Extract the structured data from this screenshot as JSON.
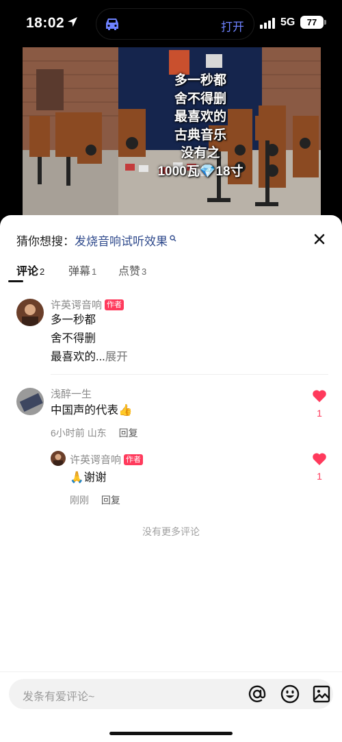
{
  "status_bar": {
    "time": "18:02",
    "island_action": "打开",
    "network": "5G",
    "battery": "77"
  },
  "video": {
    "overlay_lines": [
      "多一秒都",
      "舍不得删",
      "最喜欢的",
      "古典音乐",
      "没有之",
      "1000瓦💎18寸"
    ]
  },
  "suggest": {
    "prefix": "猜你想搜：",
    "query": "发烧音响试听效果"
  },
  "tabs": [
    {
      "label": "评论",
      "count": "2"
    },
    {
      "label": "弹幕",
      "count": "1"
    },
    {
      "label": "点赞",
      "count": "3"
    }
  ],
  "comments": [
    {
      "author": "许英谔音响",
      "badge": "作者",
      "lines": [
        "多一秒都",
        "舍不得删",
        "最喜欢的..."
      ],
      "expand": "展开"
    },
    {
      "author": "浅醉一生",
      "text": "中国声的代表👍",
      "time": "6小时前",
      "location": "山东",
      "reply": "回复",
      "likes": "1",
      "replies": [
        {
          "author": "许英谔音响",
          "badge": "作者",
          "text": "🙏谢谢",
          "time": "刚刚",
          "reply": "回复",
          "likes": "1"
        }
      ]
    }
  ],
  "no_more": "没有更多评论",
  "input": {
    "placeholder": "发条有爱评论~"
  },
  "colors": {
    "accent_link": "#2f4a8c",
    "badge": "#ff3a5c",
    "like": "#ff3a5c",
    "island_text": "#6e82ff"
  },
  "icons": [
    "location-arrow-icon",
    "car-icon",
    "signal-icon",
    "search-icon",
    "close-icon",
    "heart-icon",
    "at-icon",
    "emoji-icon",
    "image-icon"
  ]
}
